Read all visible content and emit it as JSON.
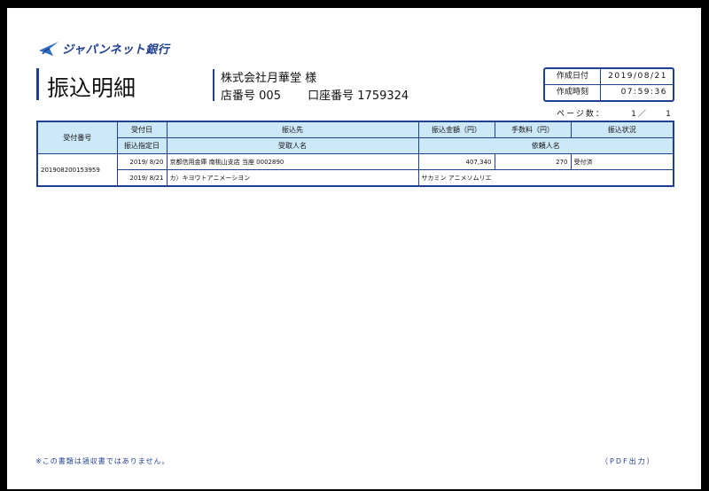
{
  "bank": {
    "name": "ジャパンネット銀行"
  },
  "doc": {
    "title": "振込明細"
  },
  "customer": {
    "company": "株式会社月華堂  様",
    "branch_label": "店番号",
    "branch_no": "005",
    "account_label": "口座番号",
    "account_no": "1759324"
  },
  "meta": {
    "created_date_label": "作成日付",
    "created_date": "2019/08/21",
    "created_time_label": "作成時刻",
    "created_time": "07:59:36"
  },
  "pagination": {
    "label": "ページ数：",
    "current": "1／",
    "total": "1"
  },
  "table": {
    "headers": {
      "receipt_no": "受付番号",
      "received_date": "受付日",
      "scheduled_date": "振込指定日",
      "destination": "振込先",
      "recipient": "受取人名",
      "amount": "振込金額（円）",
      "fee": "手数料（円）",
      "status": "振込状況",
      "requester": "依頼人名"
    },
    "row": {
      "receipt_no": "201908200153959",
      "received_date": "2019/ 8/20",
      "scheduled_date": "2019/ 8/21",
      "destination": "京都信用金庫 南桃山支店 当座 0002890",
      "recipient": "カ）キヨウトアニメーシヨン",
      "amount": "407,340",
      "fee": "270",
      "status": "受付済",
      "requester": "サカミン アニメソムリエ"
    }
  },
  "footer": {
    "note": "※この書類は領収書ではありません。",
    "pdf": "（PDF出力）"
  },
  "colors": {
    "accent": "#1f3f8f",
    "header_bg": "#cde8f8"
  }
}
